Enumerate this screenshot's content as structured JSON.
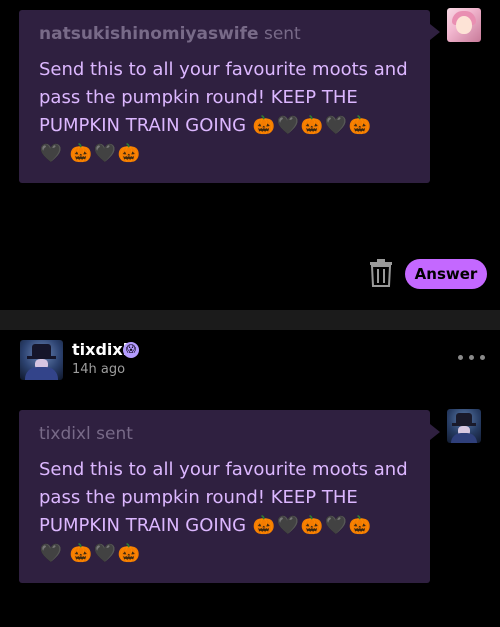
{
  "asks": [
    {
      "sender_name": "natsukishinomiyaswife",
      "sender_suffix": "sent",
      "message_text": "Send this to all your favourite moots and pass the pumpkin round! KEEP THE PUMPKIN TRAIN GOING",
      "emojis_line1": [
        "🎃",
        "🖤",
        "🎃",
        "🖤",
        "🎃"
      ],
      "emojis_line2": [
        "🖤",
        "🎃",
        "🖤",
        "🎃"
      ]
    },
    {
      "sender_name": "tixdixl",
      "sender_suffix": "sent",
      "message_text": "Send this to all your favourite moots and pass the pumpkin round! KEEP THE PUMPKIN TRAIN GOING",
      "emojis_line1": [
        "🎃",
        "🖤",
        "🎃",
        "🖤",
        "🎃"
      ],
      "emojis_line2": [
        "🖤",
        "🎃",
        "🖤",
        "🎃"
      ]
    }
  ],
  "actions": {
    "answer_label": "Answer",
    "trash_icon": "trash-icon"
  },
  "post": {
    "username": "tixdixl",
    "badge_icon": "😱",
    "timestamp": "14h ago",
    "more_icon": "more-options-icon"
  },
  "colors": {
    "background": "#000000",
    "card": "#2f2040",
    "message_text": "#dcb7ff",
    "sender_text": "#786a88",
    "accent": "#c468ff",
    "divider": "#1b1b1b"
  }
}
